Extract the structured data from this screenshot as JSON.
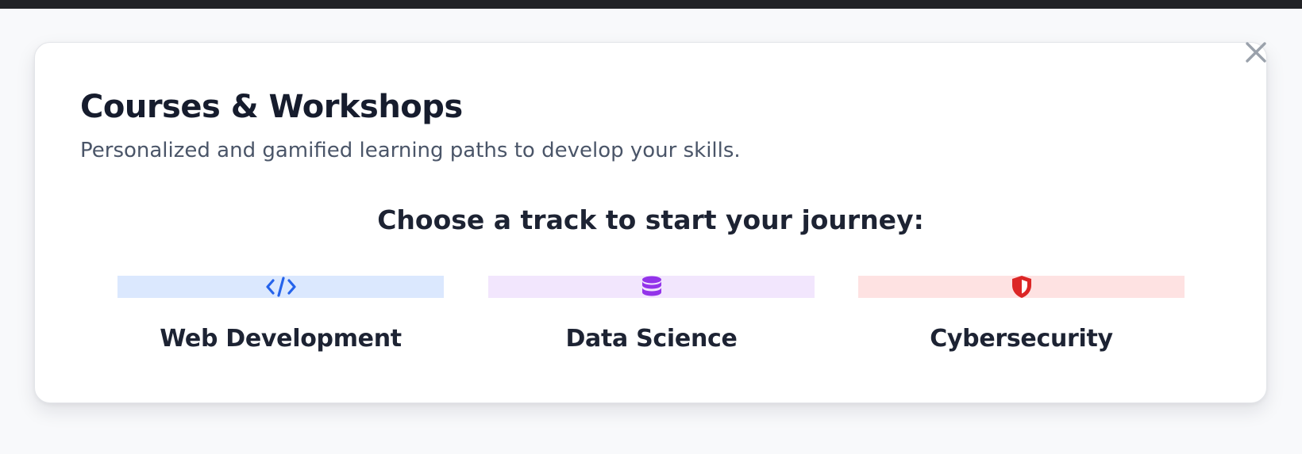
{
  "modal": {
    "title": "Courses & Workshops",
    "subtitle": "Personalized and gamified learning paths to develop your skills.",
    "prompt": "Choose a track to start your journey:",
    "close_icon": "close-icon"
  },
  "tracks": [
    {
      "label": "Web Development",
      "icon": "code-icon",
      "band_color": "#dbe8fe",
      "icon_color": "#2563eb"
    },
    {
      "label": "Data Science",
      "icon": "database-icon",
      "band_color": "#f2e6fd",
      "icon_color": "#9333ea"
    },
    {
      "label": "Cybersecurity",
      "icon": "shield-icon",
      "band_color": "#fee2e2",
      "icon_color": "#dc2626"
    }
  ],
  "colors": {
    "page_background": "#f8f9fb",
    "top_bar": "#222326",
    "heading_text": "#161c2d",
    "subtitle_text": "#4a5568",
    "close_icon": "#9aa1ab"
  }
}
